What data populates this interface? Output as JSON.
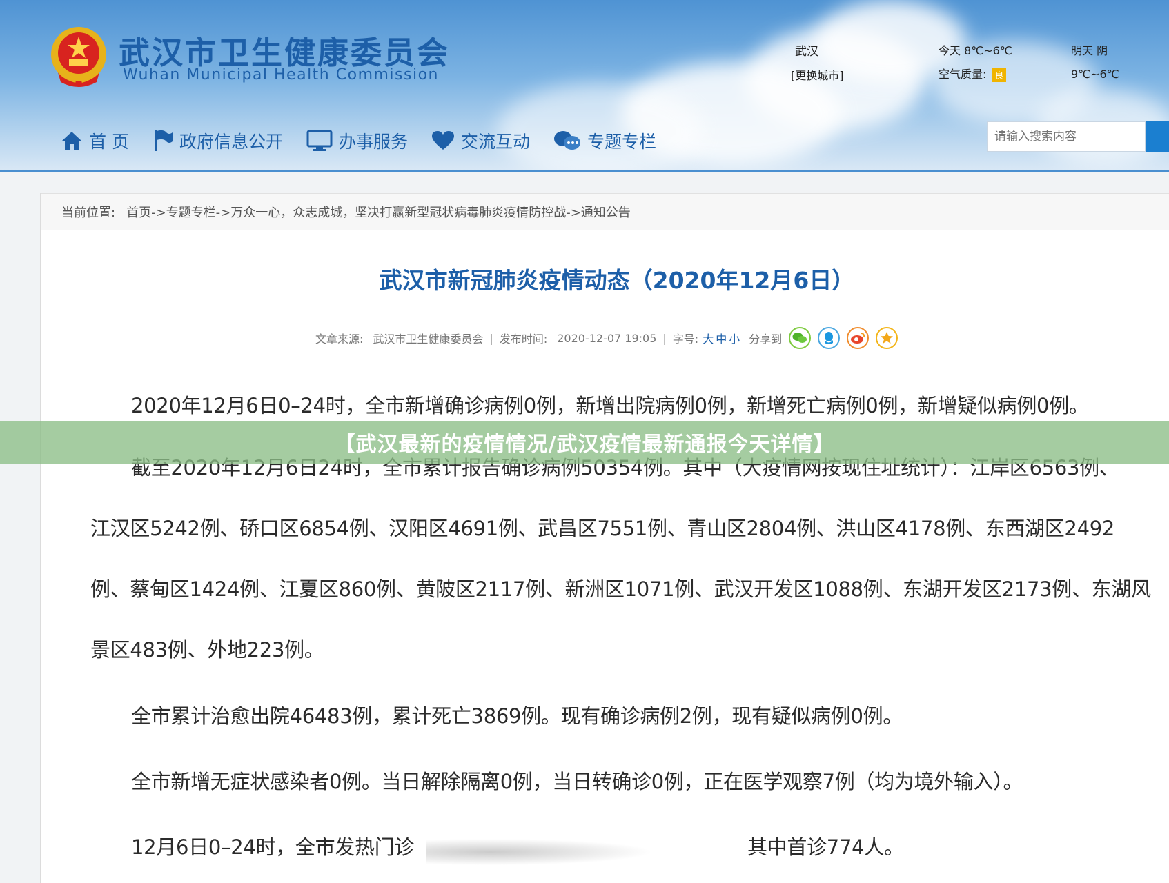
{
  "header": {
    "title_cn": "武汉市卫生健康委员会",
    "title_en": "Wuhan Municipal Health Commission",
    "city": "武汉",
    "change_city": "[更换城市]",
    "today": "今天 8℃~6℃",
    "air_quality_label": "空气质量:",
    "air_quality_value": "良",
    "tomorrow": "明天 阴",
    "tomorrow_temp": "9℃~6℃",
    "nav": [
      {
        "label": "首 页",
        "icon": "home-icon"
      },
      {
        "label": "政府信息公开",
        "icon": "flag-icon"
      },
      {
        "label": "办事服务",
        "icon": "monitor-icon"
      },
      {
        "label": "交流互动",
        "icon": "heart-icon"
      },
      {
        "label": "专题专栏",
        "icon": "chat-bubbles-icon"
      }
    ],
    "search_placeholder": "请输入搜索内容"
  },
  "breadcrumb": {
    "label": "当前位置:",
    "path": "首页->专题专栏->万众一心，众志成城，坚决打赢新型冠状病毒肺炎疫情防控战->通知公告"
  },
  "article": {
    "title": "武汉市新冠肺炎疫情动态（2020年12月6日）",
    "source_label": "文章来源:",
    "source": "武汉市卫生健康委员会",
    "time_label": "发布时间:",
    "time": "2020-12-07 19:05",
    "font_label": "字号:",
    "font_sizes": [
      "大",
      "中",
      "小"
    ],
    "share_label": "分享到",
    "share_icons": [
      "wechat-icon",
      "qq-icon",
      "weibo-icon",
      "favorite-icon"
    ],
    "paragraphs": [
      "2020年12月6日0–24时，全市新增确诊病例0例，新增出院病例0例，新增死亡病例0例，新增疑似病例0例。",
      "截至2020年12月6日24时，全市累计报告确诊病例50354例。其中（大疫情网按现住址统计）：江岸区6563例、",
      "江汉区5242例、硚口区6854例、汉阳区4691例、武昌区7551例、青山区2804例、洪山区4178例、东西湖区2492",
      "例、蔡甸区1424例、江夏区860例、黄陂区2117例、新洲区1071例、武汉开发区1088例、东湖开发区2173例、东湖风",
      "景区483例、外地223例。",
      "全市累计治愈出院46483例，累计死亡3869例。现有确诊病例2例，现有疑似病例0例。",
      "全市新增无症状感染者0例。当日解除隔离0例，当日转确诊0例，正在医学观察7例（均为境外输入）。",
      "12月6日0–24时，全市发热门诊",
      "其中首诊774人。"
    ]
  },
  "banner": "【武汉最新的疫情情况/武汉疫情最新通报今天详情】",
  "colors": {
    "brand_blue": "#1d5fa8",
    "banner_green": "#8cbe87",
    "aq_badge": "#f0b400"
  }
}
